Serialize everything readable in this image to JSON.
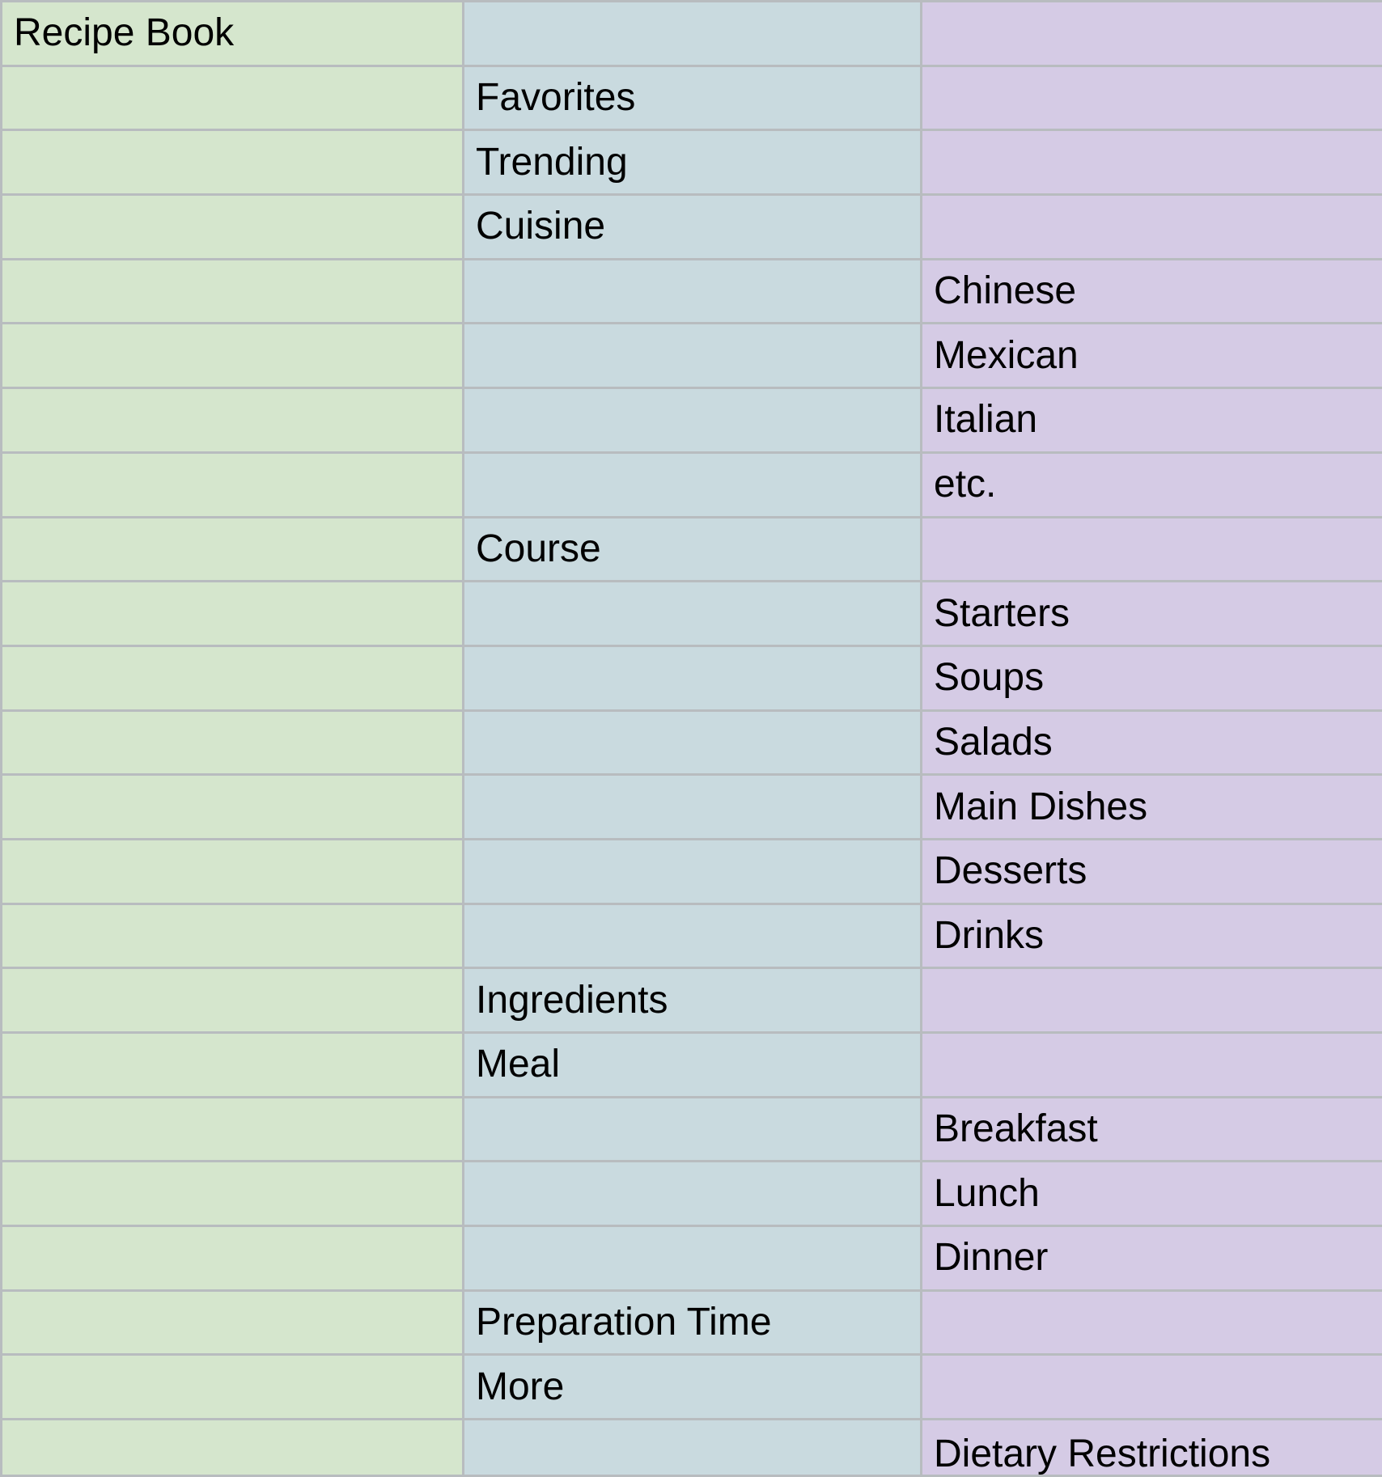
{
  "rows": [
    [
      "Recipe Book",
      "",
      ""
    ],
    [
      "",
      "Favorites",
      ""
    ],
    [
      "",
      "Trending",
      ""
    ],
    [
      "",
      "Cuisine",
      ""
    ],
    [
      "",
      "",
      "Chinese"
    ],
    [
      "",
      "",
      "Mexican"
    ],
    [
      "",
      "",
      "Italian"
    ],
    [
      "",
      "",
      "etc."
    ],
    [
      "",
      "Course",
      ""
    ],
    [
      "",
      "",
      "Starters"
    ],
    [
      "",
      "",
      "Soups"
    ],
    [
      "",
      "",
      "Salads"
    ],
    [
      "",
      "",
      "Main Dishes"
    ],
    [
      "",
      "",
      "Desserts"
    ],
    [
      "",
      "",
      "Drinks"
    ],
    [
      "",
      "Ingredients",
      ""
    ],
    [
      "",
      "Meal",
      ""
    ],
    [
      "",
      "",
      "Breakfast"
    ],
    [
      "",
      "",
      "Lunch"
    ],
    [
      "",
      "",
      "Dinner"
    ],
    [
      "",
      "Preparation Time",
      ""
    ],
    [
      "",
      "More",
      ""
    ],
    [
      "",
      "",
      "Dietary Restrictions"
    ]
  ],
  "colors": {
    "column_a": "#d5e6cd",
    "column_b": "#c9dadf",
    "column_c": "#d5cbe5",
    "gridline": "#b8bcbf"
  }
}
